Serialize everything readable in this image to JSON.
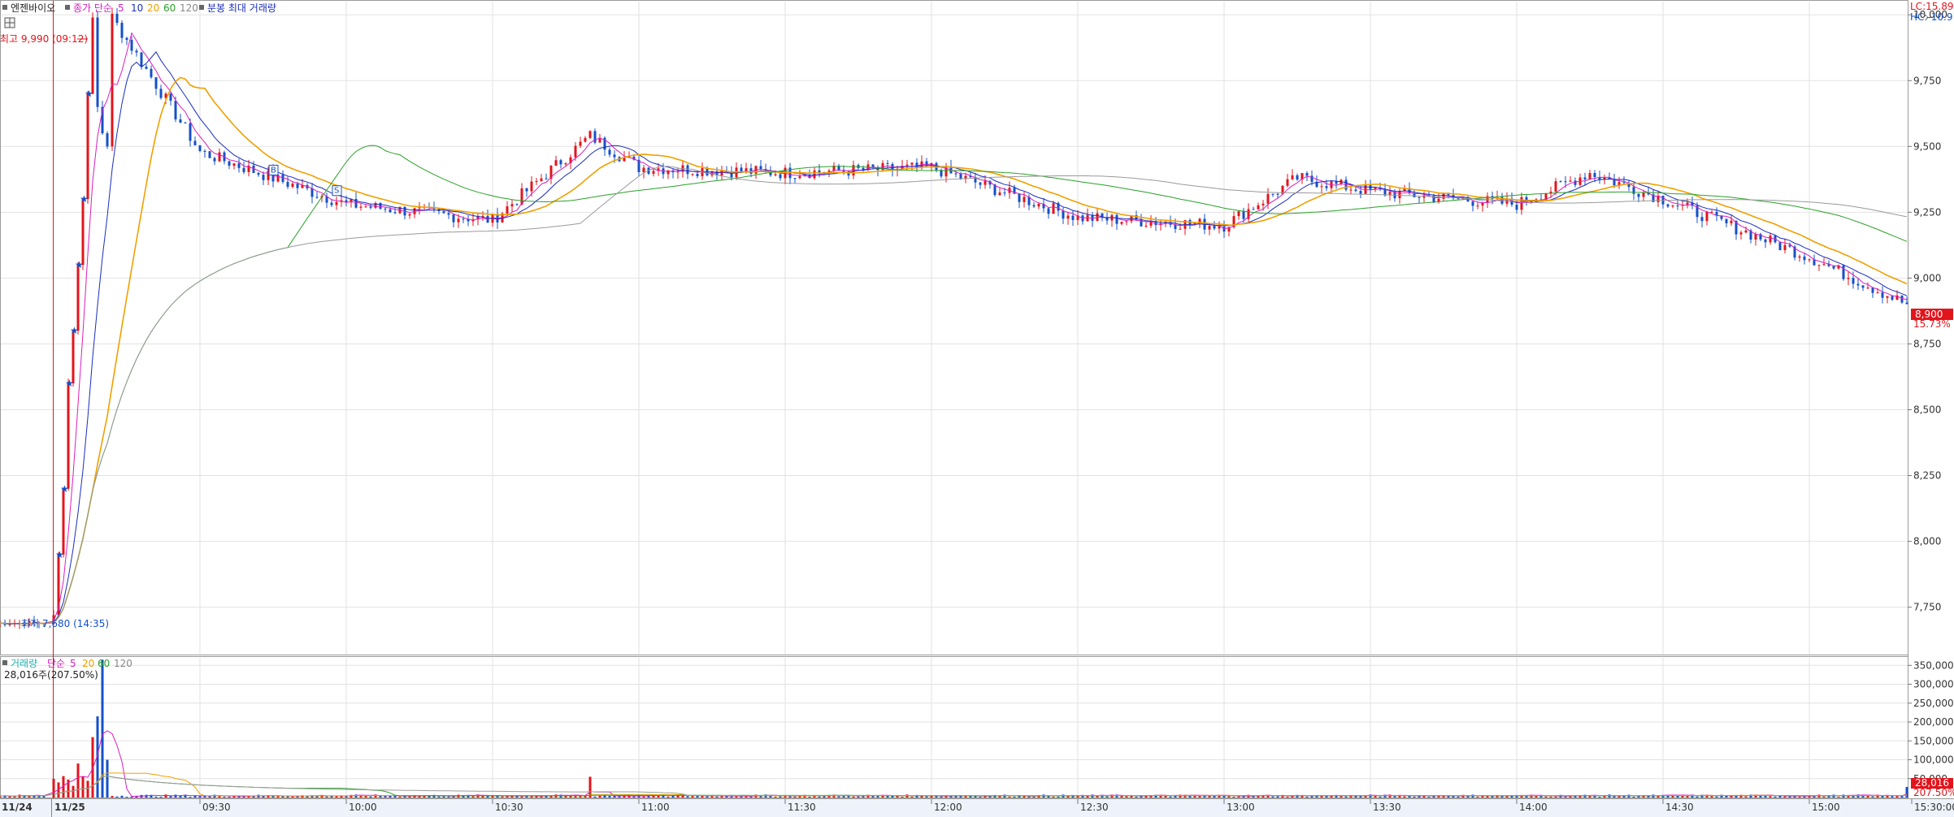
{
  "header": {
    "stock_name": "엔젠바이오",
    "ma_title": "종가 단순",
    "ma_periods": [
      "5",
      "10",
      "20",
      "60",
      "120"
    ],
    "extra": "분봉 최대 거래량"
  },
  "top_right": {
    "lc": "LC:15.89",
    "hc": "HC:-10.91"
  },
  "annotations": {
    "high": "최고 9,990 (09:12)",
    "low": "최저 7,680 (14:35)",
    "buy_marker": "B",
    "sell_marker": "S"
  },
  "current": {
    "price": "8,900",
    "pct": "15.73%"
  },
  "volume_header": {
    "title": "거래량",
    "ma_title": "단순",
    "ma_periods": [
      "5",
      "20",
      "60",
      "120"
    ],
    "value_line": "28,016주(207.50%)"
  },
  "volume_current": {
    "value": "28,016",
    "pct": "207.50%"
  },
  "colors": {
    "up": "#e3141c",
    "down": "#1450c8",
    "ma5": "#d81fc0",
    "ma10": "#1a2dbf",
    "ma20": "#f0a000",
    "ma60": "#2aa02a",
    "ma120": "#9a9a9a",
    "grid": "#e2e2e2"
  },
  "time_axis": {
    "date_labels": [
      "11/24",
      "11/25"
    ],
    "labels": [
      "09:30",
      "10:00",
      "10:30",
      "11:00",
      "11:30",
      "12:00",
      "12:30",
      "13:00",
      "13:30",
      "14:00",
      "14:30",
      "15:00",
      "15:30:00"
    ]
  },
  "chart_data": [
    {
      "type": "candlestick",
      "title": "엔젠바이오",
      "y_ticks": [
        7750,
        8000,
        8250,
        8500,
        8750,
        9000,
        9250,
        9500,
        9750,
        10000
      ],
      "ylim": [
        7570,
        10050
      ],
      "grid": true,
      "ohlc_key_points": [
        {
          "time": "11/24 14:35",
          "value": 7680,
          "label": "low"
        },
        {
          "time": "11/25 09:12",
          "value": 9990,
          "label": "high"
        },
        {
          "time": "11/25 09:30",
          "value": 9480
        },
        {
          "time": "11/25 10:00",
          "value": 9280
        },
        {
          "time": "11/25 10:30",
          "value": 9220
        },
        {
          "time": "11/25 10:50",
          "value": 9540
        },
        {
          "time": "11/25 11:00",
          "value": 9420
        },
        {
          "time": "11/25 11:30",
          "value": 9400
        },
        {
          "time": "11/25 12:00",
          "value": 9420
        },
        {
          "time": "11/25 12:30",
          "value": 9230
        },
        {
          "time": "11/25 13:00",
          "value": 9200
        },
        {
          "time": "11/25 13:15",
          "value": 9380
        },
        {
          "time": "11/25 13:30",
          "value": 9330
        },
        {
          "time": "11/25 14:00",
          "value": 9280
        },
        {
          "time": "11/25 14:15",
          "value": 9400
        },
        {
          "time": "11/25 14:30",
          "value": 9300
        },
        {
          "time": "11/25 15:00",
          "value": 9080
        },
        {
          "time": "11/25 15:20",
          "value": 8900,
          "label": "last"
        }
      ],
      "series": [
        {
          "name": "5",
          "type": "line"
        },
        {
          "name": "10",
          "type": "line"
        },
        {
          "name": "20",
          "type": "line"
        },
        {
          "name": "60",
          "type": "line"
        },
        {
          "name": "120",
          "type": "line"
        }
      ]
    },
    {
      "type": "bar",
      "title": "거래량",
      "y_ticks": [
        50000,
        100000,
        150000,
        200000,
        250000,
        300000,
        350000
      ],
      "ylim": [
        0,
        370000
      ],
      "key_points": [
        {
          "time": "11/25 09:01",
          "value": 40000
        },
        {
          "time": "11/25 09:05",
          "value": 90000
        },
        {
          "time": "11/25 09:08",
          "value": 160000
        },
        {
          "time": "11/25 09:09",
          "value": 215000
        },
        {
          "time": "11/25 09:10",
          "value": 365000
        },
        {
          "time": "11/25 09:11",
          "value": 100000
        },
        {
          "time": "11/25 10:50",
          "value": 55000
        },
        {
          "time": "11/25 15:20",
          "value": 28016,
          "label": "last"
        }
      ],
      "series": [
        {
          "name": "5",
          "type": "line"
        },
        {
          "name": "20",
          "type": "line"
        },
        {
          "name": "60",
          "type": "line"
        },
        {
          "name": "120",
          "type": "line"
        }
      ]
    }
  ]
}
